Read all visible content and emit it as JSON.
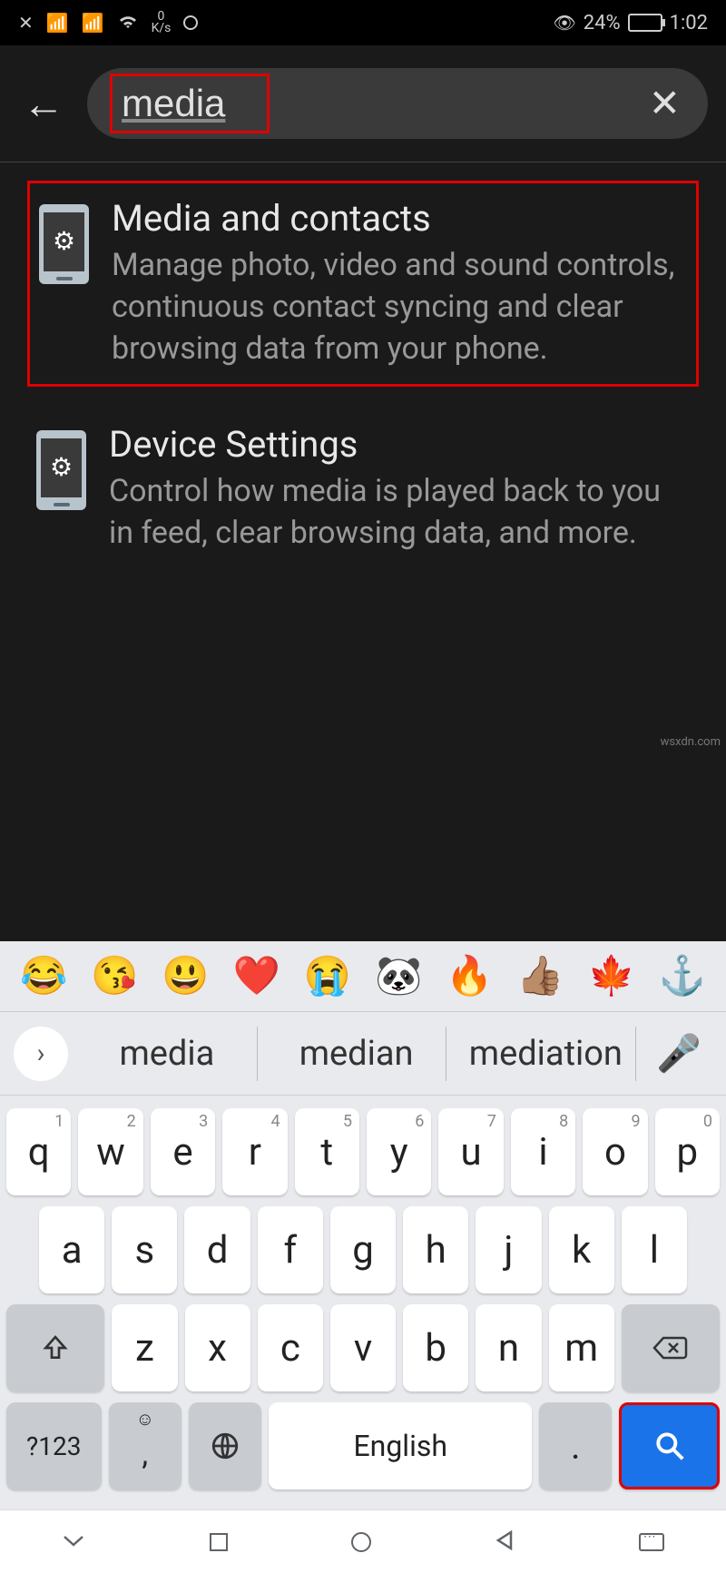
{
  "status": {
    "data_rate_top": "0",
    "data_rate_unit": "K/s",
    "battery_percent": "24%",
    "time": "1:02"
  },
  "search": {
    "value": "media"
  },
  "results": [
    {
      "title": "Media and contacts",
      "description": "Manage photo, video and sound controls, continuous contact syncing and clear browsing data from your phone."
    },
    {
      "title": "Device Settings",
      "description": "Control how media is played back to you in feed, clear browsing data, and more."
    }
  ],
  "emojis": [
    "😂",
    "😘",
    "😃",
    "❤️",
    "😭",
    "🐼",
    "🔥",
    "👍🏽",
    "🍁",
    "⚓"
  ],
  "suggestions": [
    "media",
    "median",
    "mediation"
  ],
  "keyboard": {
    "row1": [
      {
        "k": "q",
        "n": "1"
      },
      {
        "k": "w",
        "n": "2"
      },
      {
        "k": "e",
        "n": "3"
      },
      {
        "k": "r",
        "n": "4"
      },
      {
        "k": "t",
        "n": "5"
      },
      {
        "k": "y",
        "n": "6"
      },
      {
        "k": "u",
        "n": "7"
      },
      {
        "k": "i",
        "n": "8"
      },
      {
        "k": "o",
        "n": "9"
      },
      {
        "k": "p",
        "n": "0"
      }
    ],
    "row2": [
      "a",
      "s",
      "d",
      "f",
      "g",
      "h",
      "j",
      "k",
      "l"
    ],
    "row3": [
      "z",
      "x",
      "c",
      "v",
      "b",
      "n",
      "m"
    ],
    "symbols_label": "?123",
    "comma": ",",
    "space_label": "English",
    "period": "."
  },
  "watermark": "wsxdn.com"
}
